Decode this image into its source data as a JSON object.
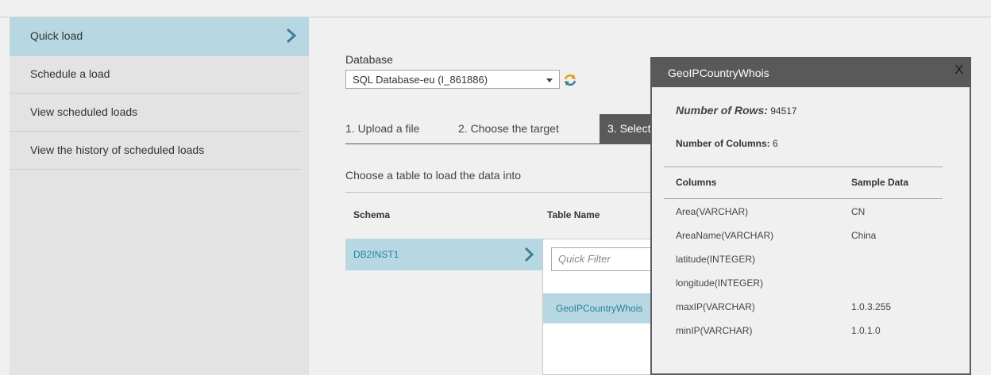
{
  "sidebar": {
    "items": [
      {
        "label": "Quick load",
        "active": true
      },
      {
        "label": "Schedule a load"
      },
      {
        "label": "View scheduled loads"
      },
      {
        "label": "View the history of scheduled loads"
      }
    ]
  },
  "database": {
    "label": "Database",
    "selected": "SQL Database-eu (I_861886)"
  },
  "steps": [
    {
      "label": "1. Upload a file"
    },
    {
      "label": "2. Choose the target"
    },
    {
      "label": "3. Select"
    }
  ],
  "choose_table": {
    "heading": "Choose a table to load the data into",
    "headers": {
      "schema": "Schema",
      "table_name": "Table Name"
    },
    "schema": "DB2INST1",
    "filter_placeholder": "Quick Filter",
    "table": "GeoIPCountryWhois"
  },
  "popup": {
    "title": "GeoIPCountryWhois",
    "close": "X",
    "rows_label": "Number of Rows:",
    "rows_value": "94517",
    "cols_label": "Number of Columns:",
    "cols_value": "6",
    "headers": {
      "columns": "Columns",
      "sample": "Sample Data"
    },
    "columns": [
      {
        "name": "Area(VARCHAR)",
        "sample": "CN"
      },
      {
        "name": "AreaName(VARCHAR)",
        "sample": "China"
      },
      {
        "name": "latitude(INTEGER)",
        "sample": ""
      },
      {
        "name": "longitude(INTEGER)",
        "sample": ""
      },
      {
        "name": "maxIP(VARCHAR)",
        "sample": "1.0.3.255"
      },
      {
        "name": "minIP(VARCHAR)",
        "sample": "1.0.1.0"
      }
    ]
  },
  "colors": {
    "selected_bg": "#b7d8e2",
    "link": "#2a7fa0",
    "dark_header": "#595959"
  }
}
